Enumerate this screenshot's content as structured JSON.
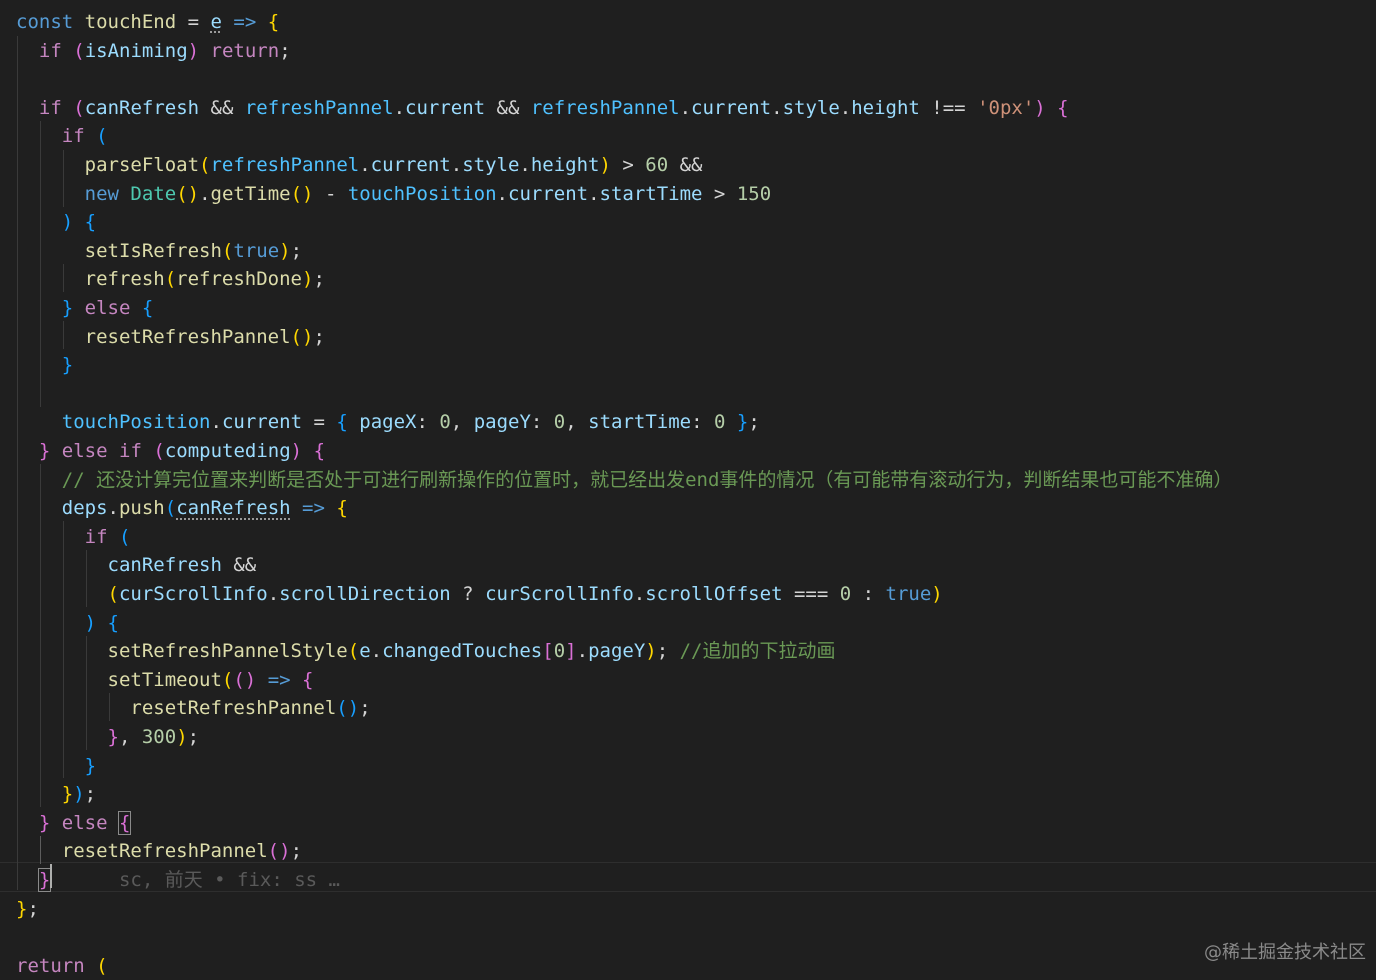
{
  "editor": {
    "lines": [
      [
        {
          "t": "const",
          "c": "kw"
        },
        {
          "t": " "
        },
        {
          "t": "touchEnd",
          "c": "fn"
        },
        {
          "t": " = "
        },
        {
          "t": "e",
          "c": "var dots"
        },
        {
          "t": " "
        },
        {
          "t": "=>",
          "c": "kw"
        },
        {
          "t": " "
        },
        {
          "t": "{",
          "c": "b1"
        }
      ],
      [
        {
          "t": "  "
        },
        {
          "t": "if",
          "c": "ctl"
        },
        {
          "t": " "
        },
        {
          "t": "(",
          "c": "b2"
        },
        {
          "t": "isAniming",
          "c": "var"
        },
        {
          "t": ")",
          "c": "b2"
        },
        {
          "t": " "
        },
        {
          "t": "return",
          "c": "ctl"
        },
        {
          "t": ";"
        }
      ],
      [],
      [
        {
          "t": "  "
        },
        {
          "t": "if",
          "c": "ctl"
        },
        {
          "t": " "
        },
        {
          "t": "(",
          "c": "b2"
        },
        {
          "t": "canRefresh",
          "c": "var"
        },
        {
          "t": " && "
        },
        {
          "t": "refreshPannel",
          "c": "con"
        },
        {
          "t": "."
        },
        {
          "t": "current",
          "c": "var"
        },
        {
          "t": " && "
        },
        {
          "t": "refreshPannel",
          "c": "con"
        },
        {
          "t": "."
        },
        {
          "t": "current",
          "c": "var"
        },
        {
          "t": "."
        },
        {
          "t": "style",
          "c": "var"
        },
        {
          "t": "."
        },
        {
          "t": "height",
          "c": "var"
        },
        {
          "t": " !== "
        },
        {
          "t": "'0px'",
          "c": "str"
        },
        {
          "t": ")",
          "c": "b2"
        },
        {
          "t": " "
        },
        {
          "t": "{",
          "c": "b2"
        }
      ],
      [
        {
          "t": "    "
        },
        {
          "t": "if",
          "c": "ctl"
        },
        {
          "t": " "
        },
        {
          "t": "(",
          "c": "b3"
        }
      ],
      [
        {
          "t": "      "
        },
        {
          "t": "parseFloat",
          "c": "fn"
        },
        {
          "t": "(",
          "c": "b1"
        },
        {
          "t": "refreshPannel",
          "c": "con"
        },
        {
          "t": "."
        },
        {
          "t": "current",
          "c": "var"
        },
        {
          "t": "."
        },
        {
          "t": "style",
          "c": "var"
        },
        {
          "t": "."
        },
        {
          "t": "height",
          "c": "var"
        },
        {
          "t": ")",
          "c": "b1"
        },
        {
          "t": " > "
        },
        {
          "t": "60",
          "c": "num"
        },
        {
          "t": " &&"
        }
      ],
      [
        {
          "t": "      "
        },
        {
          "t": "new",
          "c": "kw"
        },
        {
          "t": " "
        },
        {
          "t": "Date",
          "c": "cls"
        },
        {
          "t": "()",
          "c": "b1"
        },
        {
          "t": "."
        },
        {
          "t": "getTime",
          "c": "fn"
        },
        {
          "t": "()",
          "c": "b1"
        },
        {
          "t": " - "
        },
        {
          "t": "touchPosition",
          "c": "con"
        },
        {
          "t": "."
        },
        {
          "t": "current",
          "c": "var"
        },
        {
          "t": "."
        },
        {
          "t": "startTime",
          "c": "var"
        },
        {
          "t": " > "
        },
        {
          "t": "150",
          "c": "num"
        }
      ],
      [
        {
          "t": "    "
        },
        {
          "t": ")",
          "c": "b3"
        },
        {
          "t": " "
        },
        {
          "t": "{",
          "c": "b3"
        }
      ],
      [
        {
          "t": "      "
        },
        {
          "t": "setIsRefresh",
          "c": "fn"
        },
        {
          "t": "(",
          "c": "b1"
        },
        {
          "t": "true",
          "c": "kw"
        },
        {
          "t": ")",
          "c": "b1"
        },
        {
          "t": ";"
        }
      ],
      [
        {
          "t": "      "
        },
        {
          "t": "refresh",
          "c": "fn"
        },
        {
          "t": "(",
          "c": "b1"
        },
        {
          "t": "refreshDone",
          "c": "fn"
        },
        {
          "t": ")",
          "c": "b1"
        },
        {
          "t": ";"
        }
      ],
      [
        {
          "t": "    "
        },
        {
          "t": "}",
          "c": "b3"
        },
        {
          "t": " "
        },
        {
          "t": "else",
          "c": "ctl"
        },
        {
          "t": " "
        },
        {
          "t": "{",
          "c": "b3"
        }
      ],
      [
        {
          "t": "      "
        },
        {
          "t": "resetRefreshPannel",
          "c": "fn"
        },
        {
          "t": "()",
          "c": "b1"
        },
        {
          "t": ";"
        }
      ],
      [
        {
          "t": "    "
        },
        {
          "t": "}",
          "c": "b3"
        }
      ],
      [],
      [
        {
          "t": "    "
        },
        {
          "t": "touchPosition",
          "c": "con"
        },
        {
          "t": "."
        },
        {
          "t": "current",
          "c": "var"
        },
        {
          "t": " = "
        },
        {
          "t": "{",
          "c": "b3"
        },
        {
          "t": " "
        },
        {
          "t": "pageX",
          "c": "var"
        },
        {
          "t": ": "
        },
        {
          "t": "0",
          "c": "num"
        },
        {
          "t": ", "
        },
        {
          "t": "pageY",
          "c": "var"
        },
        {
          "t": ": "
        },
        {
          "t": "0",
          "c": "num"
        },
        {
          "t": ", "
        },
        {
          "t": "startTime",
          "c": "var"
        },
        {
          "t": ": "
        },
        {
          "t": "0",
          "c": "num"
        },
        {
          "t": " "
        },
        {
          "t": "}",
          "c": "b3"
        },
        {
          "t": ";"
        }
      ],
      [
        {
          "t": "  "
        },
        {
          "t": "}",
          "c": "b2"
        },
        {
          "t": " "
        },
        {
          "t": "else",
          "c": "ctl"
        },
        {
          "t": " "
        },
        {
          "t": "if",
          "c": "ctl"
        },
        {
          "t": " "
        },
        {
          "t": "(",
          "c": "b2"
        },
        {
          "t": "computeding",
          "c": "var"
        },
        {
          "t": ")",
          "c": "b2"
        },
        {
          "t": " "
        },
        {
          "t": "{",
          "c": "b2"
        }
      ],
      [
        {
          "t": "    "
        },
        {
          "t": "// 还没计算完位置来判断是否处于可进行刷新操作的位置时，就已经出发end事件的情况（有可能带有滚动行为，判断结果也可能不准确）",
          "c": "cmt"
        }
      ],
      [
        {
          "t": "    "
        },
        {
          "t": "deps",
          "c": "var"
        },
        {
          "t": "."
        },
        {
          "t": "push",
          "c": "fn"
        },
        {
          "t": "(",
          "c": "b3"
        },
        {
          "t": "canRefresh",
          "c": "var dots"
        },
        {
          "t": " "
        },
        {
          "t": "=>",
          "c": "kw"
        },
        {
          "t": " "
        },
        {
          "t": "{",
          "c": "b1"
        }
      ],
      [
        {
          "t": "      "
        },
        {
          "t": "if",
          "c": "ctl"
        },
        {
          "t": " "
        },
        {
          "t": "(",
          "c": "b3"
        }
      ],
      [
        {
          "t": "        "
        },
        {
          "t": "canRefresh",
          "c": "var"
        },
        {
          "t": " &&"
        }
      ],
      [
        {
          "t": "        "
        },
        {
          "t": "(",
          "c": "b1"
        },
        {
          "t": "curScrollInfo",
          "c": "var"
        },
        {
          "t": "."
        },
        {
          "t": "scrollDirection",
          "c": "var"
        },
        {
          "t": " ? "
        },
        {
          "t": "curScrollInfo",
          "c": "var"
        },
        {
          "t": "."
        },
        {
          "t": "scrollOffset",
          "c": "var"
        },
        {
          "t": " === "
        },
        {
          "t": "0",
          "c": "num"
        },
        {
          "t": " : "
        },
        {
          "t": "true",
          "c": "kw"
        },
        {
          "t": ")",
          "c": "b1"
        }
      ],
      [
        {
          "t": "      "
        },
        {
          "t": ")",
          "c": "b3"
        },
        {
          "t": " "
        },
        {
          "t": "{",
          "c": "b3"
        }
      ],
      [
        {
          "t": "        "
        },
        {
          "t": "setRefreshPannelStyle",
          "c": "fn"
        },
        {
          "t": "(",
          "c": "b1"
        },
        {
          "t": "e",
          "c": "var"
        },
        {
          "t": "."
        },
        {
          "t": "changedTouches",
          "c": "var"
        },
        {
          "t": "[",
          "c": "b2"
        },
        {
          "t": "0",
          "c": "num"
        },
        {
          "t": "]",
          "c": "b2"
        },
        {
          "t": "."
        },
        {
          "t": "pageY",
          "c": "var"
        },
        {
          "t": ")",
          "c": "b1"
        },
        {
          "t": "; "
        },
        {
          "t": "//追加的下拉动画",
          "c": "cmt"
        }
      ],
      [
        {
          "t": "        "
        },
        {
          "t": "setTimeout",
          "c": "fn"
        },
        {
          "t": "(",
          "c": "b1"
        },
        {
          "t": "()",
          "c": "b2"
        },
        {
          "t": " "
        },
        {
          "t": "=>",
          "c": "kw"
        },
        {
          "t": " "
        },
        {
          "t": "{",
          "c": "b2"
        }
      ],
      [
        {
          "t": "          "
        },
        {
          "t": "resetRefreshPannel",
          "c": "fn"
        },
        {
          "t": "()",
          "c": "b3"
        },
        {
          "t": ";"
        }
      ],
      [
        {
          "t": "        "
        },
        {
          "t": "}",
          "c": "b2"
        },
        {
          "t": ", "
        },
        {
          "t": "300",
          "c": "num"
        },
        {
          "t": ")",
          "c": "b1"
        },
        {
          "t": ";"
        }
      ],
      [
        {
          "t": "      "
        },
        {
          "t": "}",
          "c": "b3"
        }
      ],
      [
        {
          "t": "    "
        },
        {
          "t": "}",
          "c": "b1"
        },
        {
          "t": ")",
          "c": "b3"
        },
        {
          "t": ";"
        }
      ],
      [
        {
          "t": "  "
        },
        {
          "t": "}",
          "c": "b2"
        },
        {
          "t": " "
        },
        {
          "t": "else",
          "c": "ctl"
        },
        {
          "t": " "
        },
        {
          "t": "{",
          "c": "b2 cursor-box"
        }
      ],
      [
        {
          "t": "    "
        },
        {
          "t": "resetRefreshPannel",
          "c": "fn"
        },
        {
          "t": "()",
          "c": "b2"
        },
        {
          "t": ";"
        }
      ],
      [
        {
          "t": "  "
        },
        {
          "t": "}",
          "c": "b2 cursor-box"
        },
        {
          "t": "      sc, 前天 • fix: ss …",
          "c": "blame"
        }
      ],
      [
        {
          "t": "}",
          "c": "b1"
        },
        {
          "t": ";"
        }
      ],
      [],
      [
        {
          "t": "return",
          "c": "ctl"
        },
        {
          "t": " "
        },
        {
          "t": "(",
          "c": "b1"
        }
      ]
    ]
  },
  "watermark": "@稀土掘金技术社区"
}
